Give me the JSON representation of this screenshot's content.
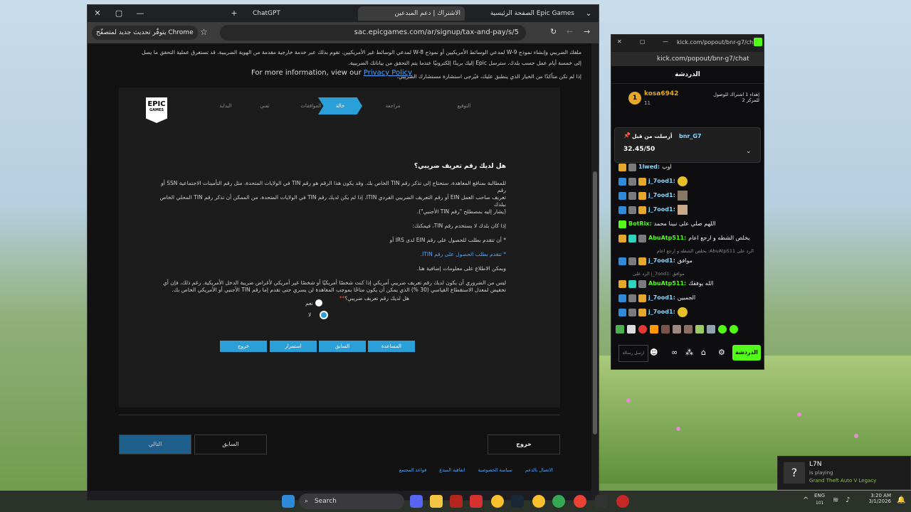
{
  "browser": {
    "tabs": [
      {
        "label": "Epic Games الصفحة الرئيسية"
      },
      {
        "label": "الاشتراك | دعم المبدعين"
      },
      {
        "label": "ChatGPT"
      }
    ],
    "update_pill": "يتوفّر تحديث جديد لمتصفّح Chrome",
    "url": "sac.epicgames.com/ar/signup/tax-and-pay/s/5"
  },
  "page": {
    "intro_line1": "ملفك الضريبي وإنشاء نموذج W-9 لمدعي الوسائط الأمريكيين أو نموذج W-8 لمدعي الوسائط غير الأمريكيين. تقوم بذلك عبر خدمة خارجية مقدمة من الهوية الضريبية. قد تستغرق عملية التحقق ما يصل",
    "intro_line2": "إلى خمسة أيام عمل حسب بلدك. سترسل Epic إليك بريدًا إلكترونيًا عندما يتم التحقق من بياناتك الضريبية.",
    "intro_line3": "إذا لم تكن متأكدًا من الخيار الذي ينطبق عليك، فيُرجى استشارة مستشارك الضريبي.",
    "more_info_prefix": "For more information, view our",
    "privacy_link": "Privacy Policy",
    "logo_top": "EPIC",
    "logo_bottom": "GAMES",
    "steps": [
      "البداية",
      "ثقني",
      "الموافقات",
      "حالة",
      "مراجعة",
      "التوقيع"
    ],
    "question_title": "هل لديك رقم تعريف ضريبي؟",
    "para1_l1": "للمطالبة بمنافع المعاهدة، ستحتاج إلى تذكر رقم TIN الخاص بك. وقد يكون هذا الرقم هو رقم TIN في الولايات المتحدة، مثل رقم التأمينات الاجتماعية SSN أو رقم",
    "para1_l2": "تعريف صاحب العمل EIN أو رقم التعريف الضريبي الفردي ITIN. إذا لم يكن لديك رقم TIN في الولايات المتحدة، من الممكن أن تذكر رقم TIN المحلي الخاص ببلدك",
    "para1_l3": "(يشار إليه بمصطلح \"رقم TIN الأجنبي\").",
    "para2": "إذا كان بلدك لا يستخدم رقم TIN، فيمكنك:",
    "bullet1": "* أن تتقدم بطلب للحصول على رقم EIN لدى IRS أو",
    "bullet2": "* تتقدم بطلب الحصول على رقم ITIN.",
    "para3": "ويمكن الاطلاع على معلومات إضافية هنا.",
    "para4_l1": "ليس من الضروري أن يكون لديك رقم تعريف ضريبي أمريكي إذا كنت شخصًا أمريكيًا أو شخصًا غير أمريكي لأغراض ضريبة الدخل الأمريكية. رغم ذلك، فإن أي",
    "para4_l2": "تخفيض لمعدل الاستقطاع القياسي (30 %) الذي يمكن أن يكون متاحًا بموجب المعاهدة لن يسري حتى تقدم إما رقم TIN الأجنبي أو الأمريكي الخاص بك.",
    "radio_question": "هل لديك رقم تعريف ضريبي؟",
    "radio_yes": "نعم",
    "radio_no": "لا",
    "panel_buttons": [
      "المساعدة",
      "السابق",
      "استمرار",
      "خروج"
    ],
    "footer_buttons": {
      "next": "التالي",
      "prev": "السابق",
      "exit": "خروج"
    },
    "footer_links": [
      "الاتصال بالدعم",
      "سياسة الخصوصية",
      "اتفاقية المبدع",
      "قواعد المجتمع"
    ]
  },
  "chat": {
    "url_title": "kick.com/popout/bnr-g7/ch...",
    "url": "kick.com/popout/bnr-g7/chat",
    "title": "الدردشة",
    "top_user": "kosa6942",
    "top_user_count": "11",
    "top_rank": "1",
    "gift_text": "إهداء 1 اشتراك للوصول",
    "gift_text2": "للمركز 2",
    "pinned_by": "أرسلت من قبل",
    "pinned_user": "bnr_G7",
    "pinned_text": "32.45/50",
    "messages": [
      {
        "user": "1lwed:",
        "text": "اوب",
        "color": "user-blue"
      },
      {
        "user": "j_7ood1:",
        "text": "",
        "color": "user-blue"
      },
      {
        "user": "j_7ood1:",
        "text": "",
        "color": "user-blue"
      },
      {
        "user": "j_7ood1:",
        "text": "",
        "color": "user-blue"
      },
      {
        "user": "BotRix:",
        "text": "اللهم صلي على نبينا محمد",
        "color": "user-green"
      },
      {
        "user": "AbuAtp511:",
        "text": "يخلص الشطه و ارجع اعام",
        "color": "user-green"
      },
      {
        "user": "j_7ood1:",
        "text": "موافق",
        "color": "user-blue"
      },
      {
        "user": "AbuAtp511:",
        "text": "الله يوفقك",
        "color": "user-green"
      },
      {
        "user": "j_7ood1:",
        "text": "الجميين",
        "color": "user-blue"
      },
      {
        "user": "j_7ood1:",
        "text": "",
        "color": "user-blue"
      }
    ],
    "reply1": "الرد على AbuAtp511: يخلص الشطه و ارجع اعام",
    "reply2": "الرد على j_7ood1: موافق",
    "send_button": "الدردشة",
    "input_placeholder": "ارسل رسالة"
  },
  "taskbar": {
    "search": "Search",
    "time": "3:20 AM",
    "date": "3/1/2026",
    "lang": "ENG",
    "battery": "101"
  },
  "toast": {
    "user": "L7N",
    "status": "is playing",
    "game": "Grand Theft Auto V Legacy"
  }
}
